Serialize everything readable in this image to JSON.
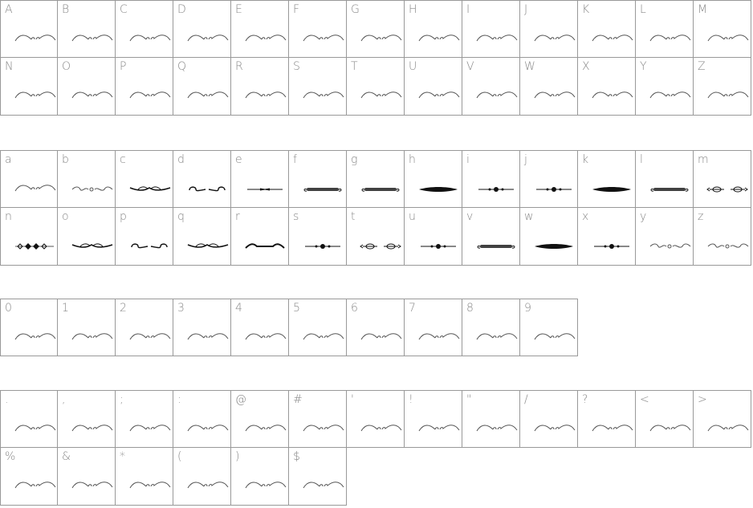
{
  "sections": [
    {
      "id": "uppercase",
      "cells": [
        {
          "char": "A",
          "glyph": "swash"
        },
        {
          "char": "B",
          "glyph": "swash"
        },
        {
          "char": "C",
          "glyph": "swash"
        },
        {
          "char": "D",
          "glyph": "swash"
        },
        {
          "char": "E",
          "glyph": "swash"
        },
        {
          "char": "F",
          "glyph": "swash"
        },
        {
          "char": "G",
          "glyph": "swash"
        },
        {
          "char": "H",
          "glyph": "swash"
        },
        {
          "char": "I",
          "glyph": "swash"
        },
        {
          "char": "J",
          "glyph": "swash"
        },
        {
          "char": "K",
          "glyph": "swash"
        },
        {
          "char": "L",
          "glyph": "swash"
        },
        {
          "char": "M",
          "glyph": "swash"
        },
        {
          "char": "N",
          "glyph": "swash"
        },
        {
          "char": "O",
          "glyph": "swash"
        },
        {
          "char": "P",
          "glyph": "swash"
        },
        {
          "char": "Q",
          "glyph": "swash"
        },
        {
          "char": "R",
          "glyph": "swash"
        },
        {
          "char": "S",
          "glyph": "swash"
        },
        {
          "char": "T",
          "glyph": "swash"
        },
        {
          "char": "U",
          "glyph": "swash"
        },
        {
          "char": "V",
          "glyph": "swash"
        },
        {
          "char": "W",
          "glyph": "swash"
        },
        {
          "char": "X",
          "glyph": "swash"
        },
        {
          "char": "Y",
          "glyph": "swash"
        },
        {
          "char": "Z",
          "glyph": "swash"
        }
      ]
    },
    {
      "id": "lowercase",
      "cells": [
        {
          "char": "a",
          "glyph": "swash"
        },
        {
          "char": "b",
          "glyph": "loops"
        },
        {
          "char": "c",
          "glyph": "wing"
        },
        {
          "char": "d",
          "glyph": "curl"
        },
        {
          "char": "e",
          "glyph": "thin-line"
        },
        {
          "char": "f",
          "glyph": "floral-bar"
        },
        {
          "char": "g",
          "glyph": "floral-bar"
        },
        {
          "char": "h",
          "glyph": "lens"
        },
        {
          "char": "i",
          "glyph": "beaded"
        },
        {
          "char": "j",
          "glyph": "beaded"
        },
        {
          "char": "k",
          "glyph": "lens"
        },
        {
          "char": "l",
          "glyph": "floral-bar"
        },
        {
          "char": "m",
          "glyph": "arrows"
        },
        {
          "char": "n",
          "glyph": "diamonds"
        },
        {
          "char": "o",
          "glyph": "wing"
        },
        {
          "char": "p",
          "glyph": "curl"
        },
        {
          "char": "q",
          "glyph": "wing"
        },
        {
          "char": "r",
          "glyph": "wave"
        },
        {
          "char": "s",
          "glyph": "beaded"
        },
        {
          "char": "t",
          "glyph": "arrows"
        },
        {
          "char": "u",
          "glyph": "beaded"
        },
        {
          "char": "v",
          "glyph": "floral-bar"
        },
        {
          "char": "w",
          "glyph": "lens"
        },
        {
          "char": "x",
          "glyph": "beaded"
        },
        {
          "char": "y",
          "glyph": "loops"
        },
        {
          "char": "z",
          "glyph": "loops"
        }
      ]
    },
    {
      "id": "digits",
      "cells": [
        {
          "char": "0",
          "glyph": "swash"
        },
        {
          "char": "1",
          "glyph": "swash"
        },
        {
          "char": "2",
          "glyph": "swash"
        },
        {
          "char": "3",
          "glyph": "swash"
        },
        {
          "char": "4",
          "glyph": "swash"
        },
        {
          "char": "5",
          "glyph": "swash"
        },
        {
          "char": "6",
          "glyph": "swash"
        },
        {
          "char": "7",
          "glyph": "swash"
        },
        {
          "char": "8",
          "glyph": "swash"
        },
        {
          "char": "9",
          "glyph": "swash"
        }
      ]
    },
    {
      "id": "punctuation",
      "cells": [
        {
          "char": ".",
          "glyph": "swash"
        },
        {
          "char": ",",
          "glyph": "swash"
        },
        {
          "char": ";",
          "glyph": "swash"
        },
        {
          "char": ":",
          "glyph": "swash"
        },
        {
          "char": "@",
          "glyph": "swash"
        },
        {
          "char": "#",
          "glyph": "swash"
        },
        {
          "char": "'",
          "glyph": "swash"
        },
        {
          "char": "!",
          "glyph": "swash"
        },
        {
          "char": "\"",
          "glyph": "swash"
        },
        {
          "char": "/",
          "glyph": "swash"
        },
        {
          "char": "?",
          "glyph": "swash"
        },
        {
          "char": "<",
          "glyph": "swash"
        },
        {
          "char": ">",
          "glyph": "swash"
        },
        {
          "char": "%",
          "glyph": "swash"
        },
        {
          "char": "&",
          "glyph": "swash"
        },
        {
          "char": "*",
          "glyph": "swash"
        },
        {
          "char": "(",
          "glyph": "swash"
        },
        {
          "char": ")",
          "glyph": "swash"
        },
        {
          "char": "$",
          "glyph": "swash"
        }
      ]
    }
  ],
  "colors": {
    "grid_line": "#999999",
    "label": "#888888",
    "glyph_light": "#555555",
    "glyph_dark": "#111111"
  }
}
